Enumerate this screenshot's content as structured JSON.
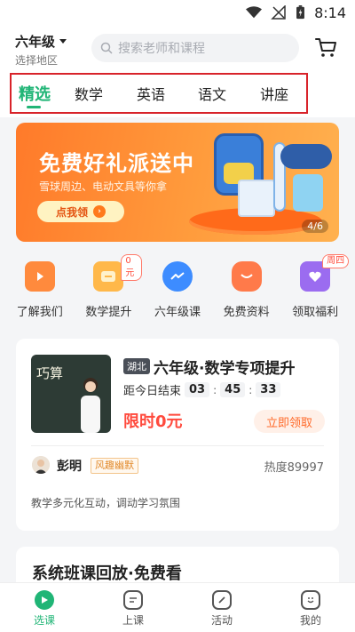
{
  "status_bar": {
    "time": "8:14"
  },
  "header": {
    "grade": "六年级",
    "region_hint": "选择地区",
    "search_placeholder": "搜索老师和课程"
  },
  "tabs": [
    {
      "label": "精选",
      "active": true
    },
    {
      "label": "数学"
    },
    {
      "label": "英语"
    },
    {
      "label": "语文"
    },
    {
      "label": "讲座"
    }
  ],
  "banner": {
    "title": "免费好礼派送中",
    "subtitle": "雪球周边、电动文具等你拿",
    "button": "点我领",
    "counter": "4/6"
  },
  "quick_entries": [
    {
      "label": "了解我们",
      "icon": "play-icon",
      "color": "#ff8a3d"
    },
    {
      "label": "数学提升",
      "icon": "chat-icon",
      "color": "#ffb84a",
      "badge": "0元"
    },
    {
      "label": "六年级课",
      "icon": "messenger-icon",
      "color": "#3d8cff"
    },
    {
      "label": "免费资料",
      "icon": "gift-icon",
      "color": "#ff7a4a"
    },
    {
      "label": "领取福利",
      "icon": "heart-icon",
      "color": "#9b6cf0",
      "badge": "周四"
    }
  ],
  "course_card": {
    "region": "湖北",
    "title": "六年级·数学专项提升",
    "countdown_label": "距今日结束",
    "hours": "03",
    "minutes": "45",
    "seconds": "33",
    "price": "限时0元",
    "claim_button": "立即领取",
    "teacher_name": "彭明",
    "teacher_tag": "风趣幽默",
    "heat": "热度89997",
    "description": "教学多元化互动，调动学习氛围",
    "thumbnail_text": "巧算"
  },
  "section2": {
    "title": "系统班课回放·免费看"
  },
  "bottom_nav": [
    {
      "label": "选课",
      "active": true,
      "icon": "course-select-icon"
    },
    {
      "label": "上课",
      "icon": "class-icon"
    },
    {
      "label": "活动",
      "icon": "activity-icon"
    },
    {
      "label": "我的",
      "icon": "profile-icon"
    }
  ],
  "colors": {
    "accent": "#20b576",
    "price": "#ff4a3d",
    "highlight_box": "#d8232a"
  }
}
